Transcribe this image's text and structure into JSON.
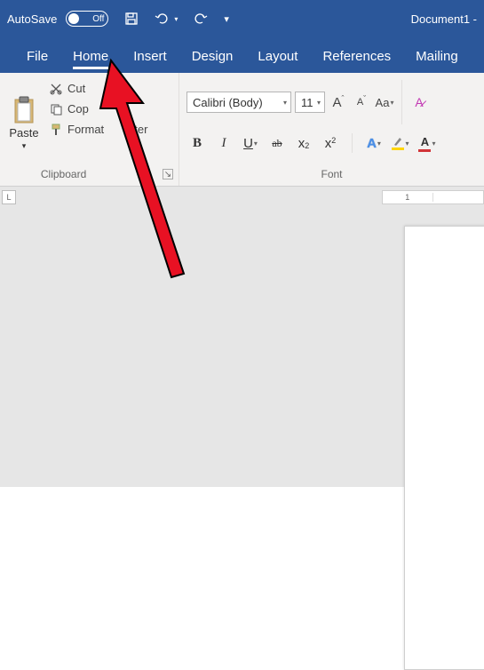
{
  "titlebar": {
    "autosave_label": "AutoSave",
    "autosave_state": "Off",
    "document_title": "Document1 -"
  },
  "menu": {
    "file": "File",
    "home": "Home",
    "insert": "Insert",
    "design": "Design",
    "layout": "Layout",
    "references": "References",
    "mailings": "Mailing"
  },
  "ribbon": {
    "clipboard": {
      "paste": "Paste",
      "cut": "Cut",
      "copy": "Cop",
      "format_painter": "Format",
      "format_painter2": "inter",
      "group_label": "Clipboard"
    },
    "font": {
      "name": "Calibri (Body)",
      "size": "11",
      "bold": "B",
      "italic": "I",
      "underline": "U",
      "strike": "ab",
      "sub": "x",
      "sup": "x",
      "Aa": "Aa",
      "group_label": "Font"
    }
  },
  "ruler": {
    "tick1": "1"
  }
}
